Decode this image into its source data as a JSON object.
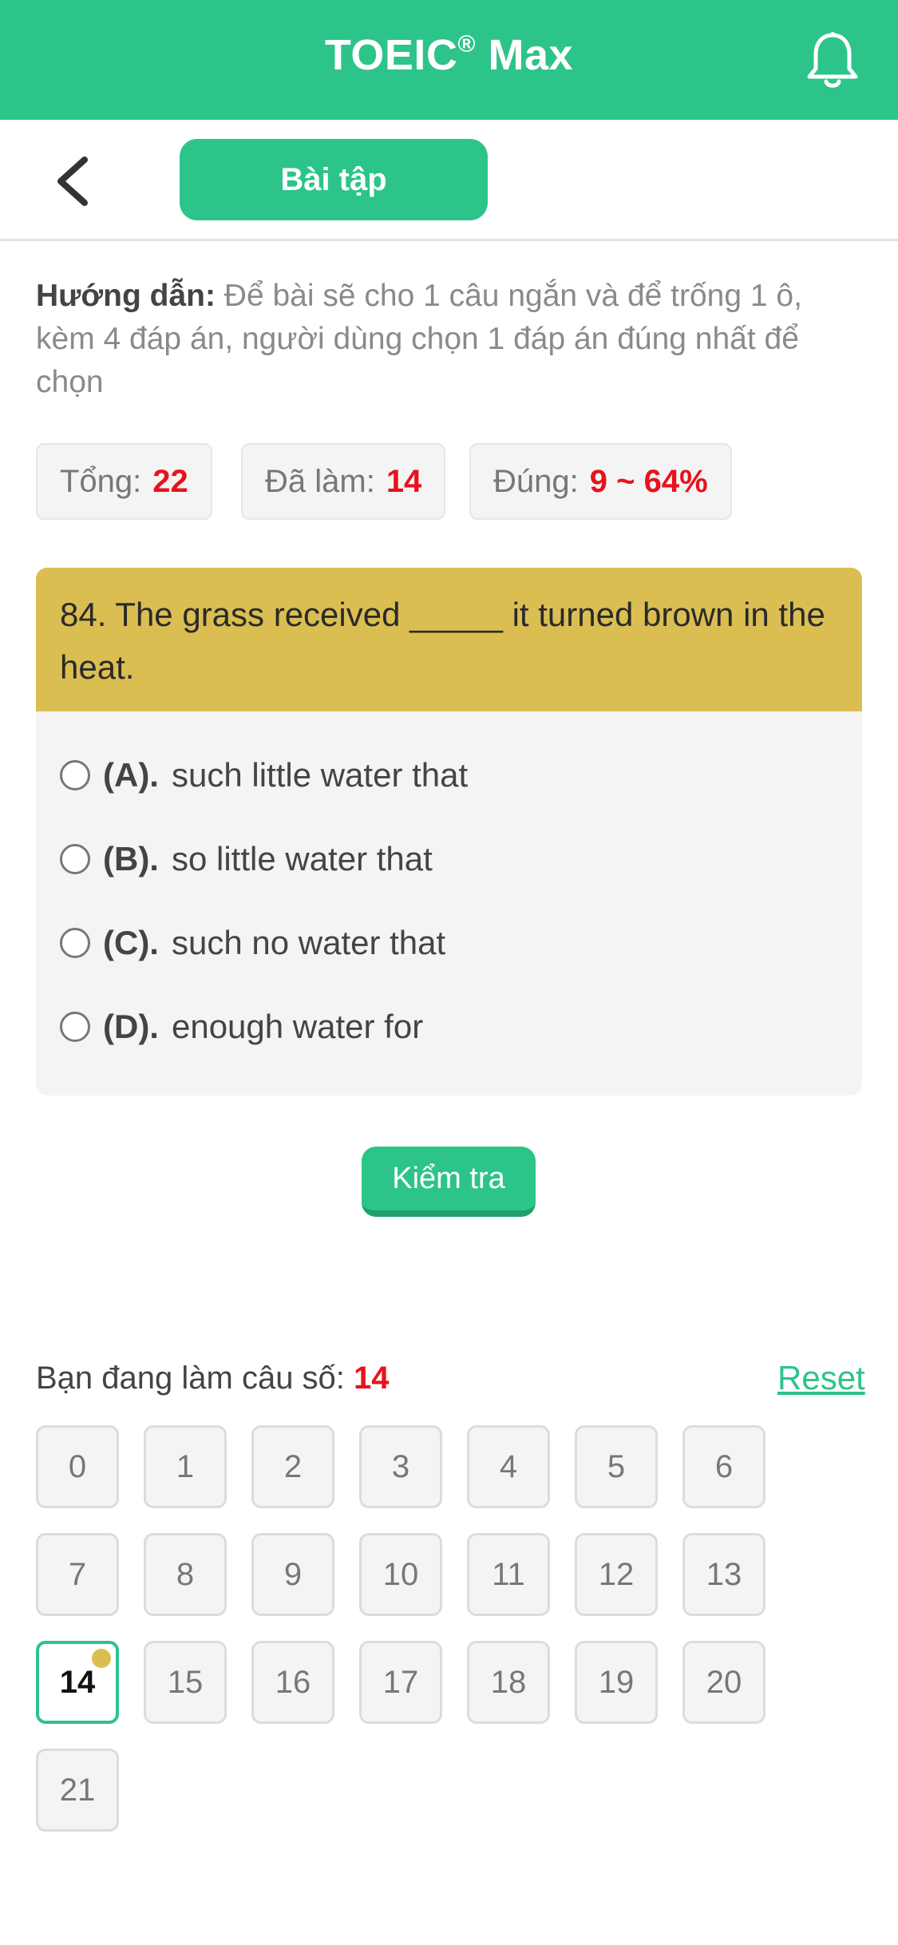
{
  "header": {
    "title": "TOEIC",
    "title_mark": "®",
    "title_suffix": "Max",
    "bell_icon": "bell-icon",
    "color": "#2dc489"
  },
  "subbar": {
    "back_icon": "chevron-left-icon",
    "tab_label": "Bài tập"
  },
  "instructions": {
    "label": "Hướng dẫn:",
    "text": "Để bài sẽ cho 1 câu ngắn và để trống 1 ô, kèm 4 đáp án, người dùng chọn 1 đáp án đúng nhất để chọn"
  },
  "stats": {
    "total_label": "Tổng:",
    "total_value": "22",
    "done_label": "Đã làm:",
    "done_value": "14",
    "correct_label": "Đúng:",
    "correct_value": "9 ~ 64%"
  },
  "question": {
    "text": "84. The grass received _____ it turned brown in the heat.",
    "options": [
      {
        "letter": "(A).",
        "text": "such little water that"
      },
      {
        "letter": "(B).",
        "text": "so little water that"
      },
      {
        "letter": "(C).",
        "text": "such no water that"
      },
      {
        "letter": "(D).",
        "text": "enough water for"
      }
    ]
  },
  "check_button": "Kiểm tra",
  "progress": {
    "label": "Bạn đang làm câu số:",
    "current": "14",
    "reset": "Reset"
  },
  "question_numbers": [
    "0",
    "1",
    "2",
    "3",
    "4",
    "5",
    "6",
    "7",
    "8",
    "9",
    "10",
    "11",
    "12",
    "13",
    "14",
    "15",
    "16",
    "17",
    "18",
    "19",
    "20",
    "21"
  ],
  "active_question": "14",
  "accent_yellow": "#dbbe52",
  "accent_red": "#e8121c"
}
